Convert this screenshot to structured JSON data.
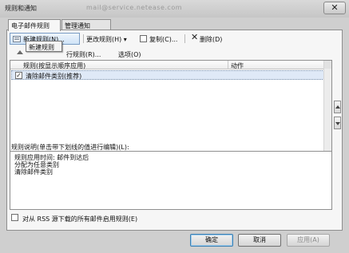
{
  "window": {
    "title": "规则和通知",
    "account": "mail@service.netease.com",
    "close_glyph": "✕"
  },
  "tabs": [
    {
      "label": "电子邮件规则",
      "active": true
    },
    {
      "label": "管理通知",
      "active": false
    }
  ],
  "toolbar": {
    "new_rule": "新建规则(N)...",
    "change_rule": "更改规则(H) ▾",
    "copy": "复制(C)...",
    "delete": "删除(D)",
    "delete_glyph": "✕"
  },
  "tooltip": "新建规则",
  "row2": {
    "run_rules": "行规则(R)...",
    "options": "选项(O)"
  },
  "rules_list": {
    "columns": [
      "规则(按显示顺序应用)",
      "动作"
    ],
    "rows": [
      {
        "checked": true,
        "label": "清除邮件类别(推荐)",
        "action_icon": "rule-action-icon"
      }
    ]
  },
  "description": {
    "label": "规则说明(单击带下划线的值进行编辑)(L):",
    "lines": [
      "规则应用时间: 邮件到达后",
      "分配为任意类别",
      "清除邮件类别"
    ]
  },
  "rss": {
    "checked": false,
    "label": "对从 RSS 源下载的所有邮件启用规则(E)"
  },
  "buttons": {
    "ok": "确定",
    "cancel": "取消",
    "apply": "应用(A)"
  },
  "colors": {
    "selection": "#dfe9f7",
    "default_button_border": "#3c7fb1",
    "disabled_text": "#8b8b8b"
  }
}
